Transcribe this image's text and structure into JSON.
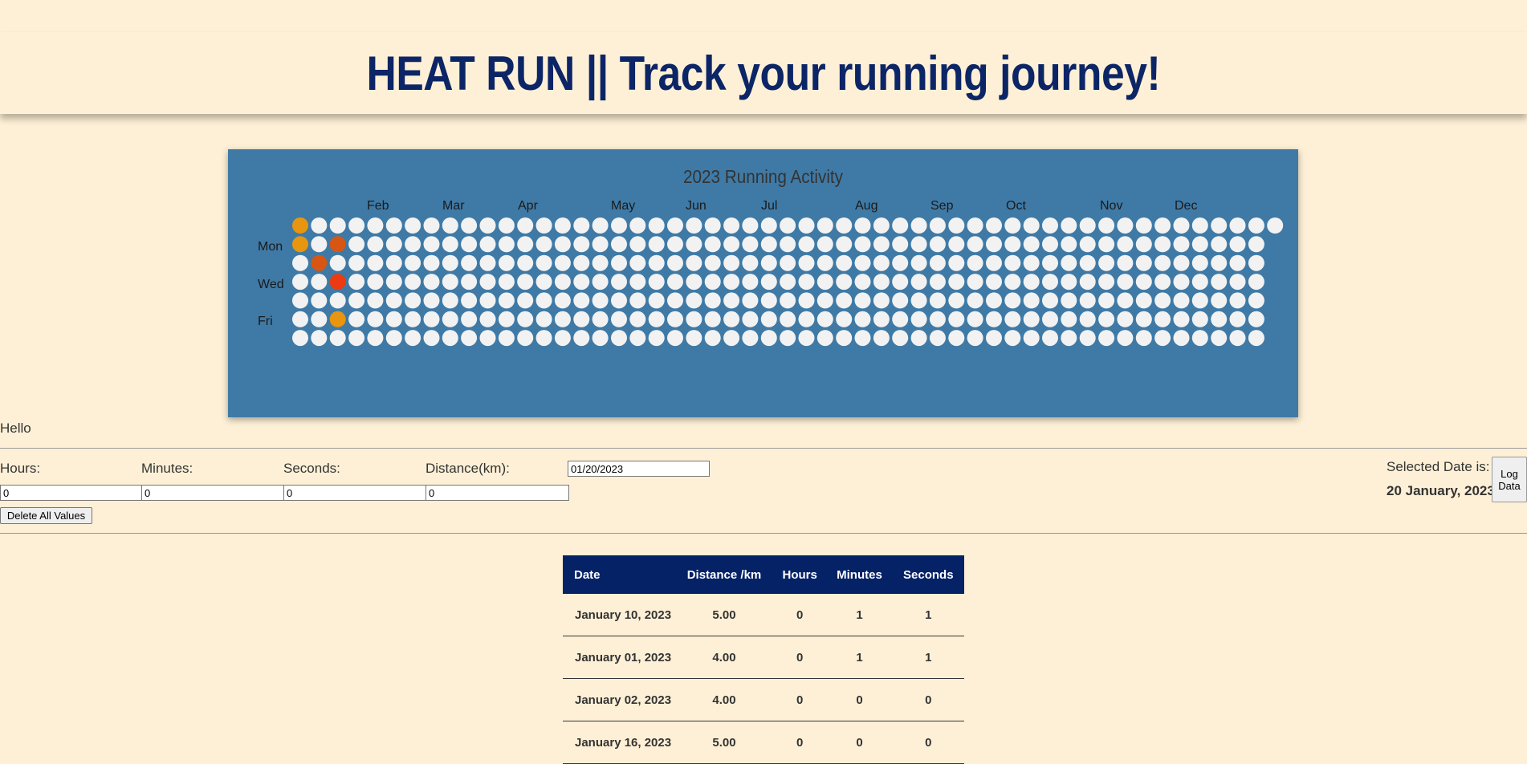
{
  "header": {
    "title": "HEAT RUN || Track your running journey!"
  },
  "heatmap": {
    "title": "2023 Running Activity",
    "months": [
      "Feb",
      "Mar",
      "Apr",
      "May",
      "Jun",
      "Jul",
      "Aug",
      "Sep",
      "Oct",
      "Nov",
      "Dec"
    ],
    "days": [
      "Mon",
      "Wed",
      "Fri"
    ],
    "colors": {
      "empty": "#f2f2f2",
      "low": "#e8960f",
      "mid": "#d75613",
      "high": "#ea3b12",
      "panel": "#3f7aa6"
    },
    "active_days": [
      {
        "week": 0,
        "day": 0,
        "level": "low"
      },
      {
        "week": 0,
        "day": 1,
        "level": "low"
      },
      {
        "week": 1,
        "day": 2,
        "level": "mid"
      },
      {
        "week": 2,
        "day": 1,
        "level": "mid"
      },
      {
        "week": 2,
        "day": 3,
        "level": "high"
      },
      {
        "week": 2,
        "day": 5,
        "level": "low"
      }
    ]
  },
  "greeting": "Hello",
  "form": {
    "hours_label": "Hours:",
    "minutes_label": "Minutes:",
    "seconds_label": "Seconds:",
    "distance_label": "Distance(km):",
    "hours_value": "0",
    "minutes_value": "0",
    "seconds_value": "0",
    "distance_value": "0",
    "date_value": "01/20/2023",
    "delete_label": "Delete All Values",
    "selected_label": "Selected Date is:",
    "selected_value": "20 January, 2023",
    "log_label": "Log Data"
  },
  "table": {
    "headers": {
      "date": "Date",
      "distance": "Distance /km",
      "hours": "Hours",
      "minutes": "Minutes",
      "seconds": "Seconds"
    },
    "rows": [
      {
        "date": "January 10, 2023",
        "distance": "5.00",
        "hours": "0",
        "minutes": "1",
        "seconds": "1"
      },
      {
        "date": "January 01, 2023",
        "distance": "4.00",
        "hours": "0",
        "minutes": "1",
        "seconds": "1"
      },
      {
        "date": "January 02, 2023",
        "distance": "4.00",
        "hours": "0",
        "minutes": "0",
        "seconds": "0"
      },
      {
        "date": "January 16, 2023",
        "distance": "5.00",
        "hours": "0",
        "minutes": "0",
        "seconds": "0"
      }
    ]
  }
}
